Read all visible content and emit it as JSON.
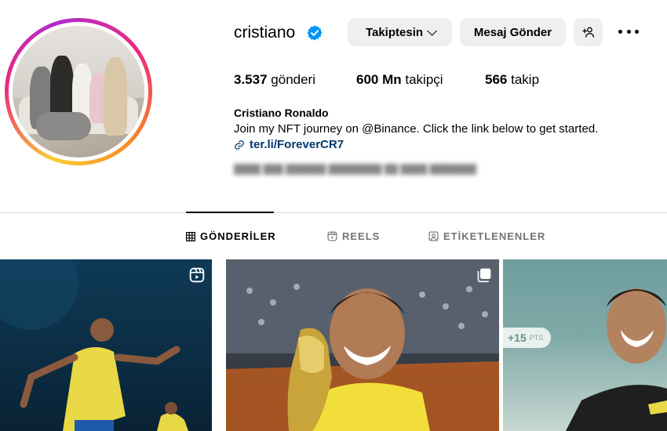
{
  "profile": {
    "username": "cristiano",
    "verified": true,
    "full_name": "Cristiano Ronaldo",
    "bio": "Join my NFT journey on @Binance. Click the link below to get started.",
    "link": "ter.li/ForeverCR7",
    "blurred_text": "████ ███ ██████ ████████ ██ ████ ███████"
  },
  "actions": {
    "follow_label": "Takiptesin",
    "message_label": "Mesaj Gönder",
    "add_user_icon": "add-user-icon",
    "more_icon": "more-options-icon"
  },
  "stats": {
    "posts_value": "3.537",
    "posts_label": "gönderi",
    "followers_value": "600 Mn",
    "followers_label": "takipçi",
    "following_value": "566",
    "following_label": "takip"
  },
  "tabs": [
    {
      "label": "GÖNDERİLER",
      "icon": "grid-icon",
      "active": true
    },
    {
      "label": "REELS",
      "icon": "reels-icon",
      "active": false
    },
    {
      "label": "ETİKETLENENLER",
      "icon": "tagged-icon",
      "active": false
    }
  ],
  "posts": [
    {
      "type": "reel",
      "icon": "reel-icon"
    },
    {
      "type": "carousel",
      "icon": "carousel-icon"
    },
    {
      "type": "image",
      "badge_value": "+15",
      "badge_unit": "PTS"
    }
  ],
  "colors": {
    "verified": "#0095f6",
    "link": "#00376b",
    "button_bg": "#efefef",
    "tab_inactive": "#737373"
  }
}
